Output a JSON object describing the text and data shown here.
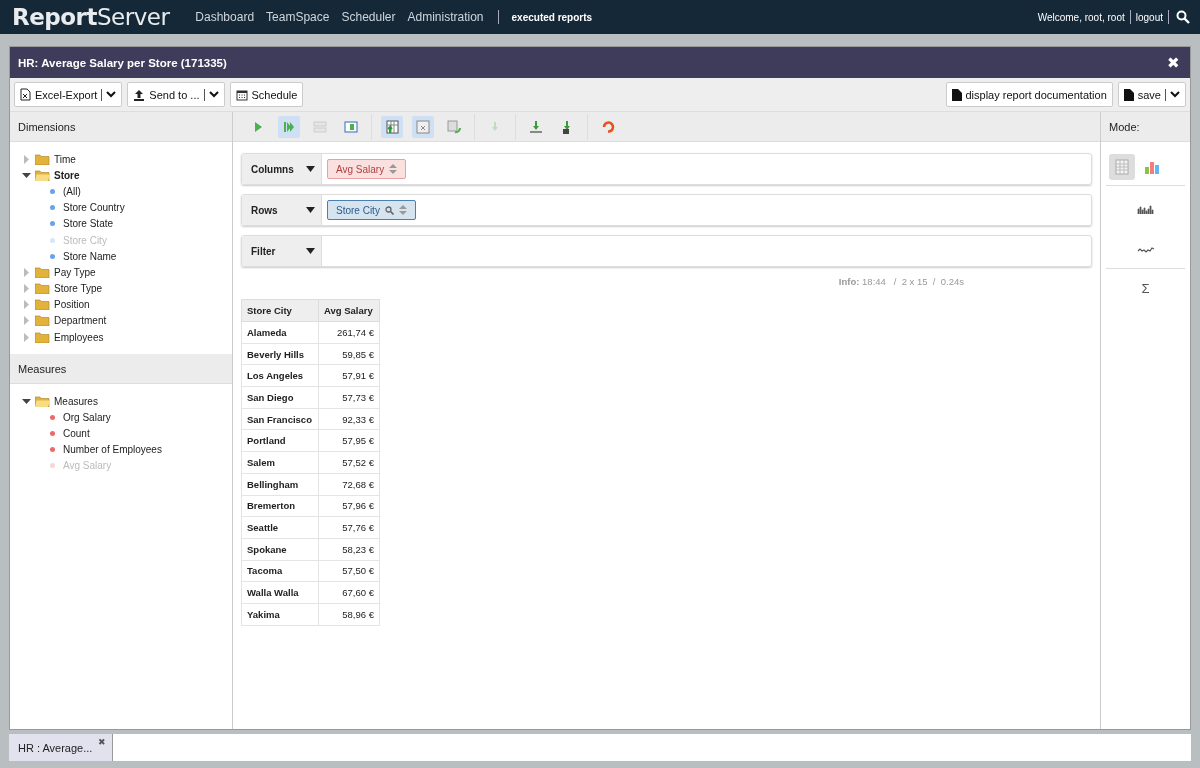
{
  "topbar": {
    "logo_bold": "Report",
    "logo_light": "Server",
    "nav": [
      "Dashboard",
      "TeamSpace",
      "Scheduler",
      "Administration"
    ],
    "current": "executed reports",
    "welcome": "Welcome, root, root",
    "logout": "logout"
  },
  "window": {
    "title": "HR: Average Salary per Store (171335)",
    "close": "✖"
  },
  "toolbar": {
    "left": [
      {
        "label": "Excel-Export",
        "kind": "excel",
        "dropdown": true
      },
      {
        "label": "Send to ...",
        "kind": "upload",
        "dropdown": true
      },
      {
        "label": "Schedule",
        "kind": "calendar",
        "dropdown": false
      }
    ],
    "right": [
      {
        "label": "display report documentation",
        "kind": "doc",
        "dropdown": false
      },
      {
        "label": "save",
        "kind": "doc",
        "dropdown": true
      }
    ]
  },
  "dimensions": {
    "title": "Dimensions",
    "items": [
      {
        "label": "Time",
        "kind": "folder",
        "expanded": false
      },
      {
        "label": "Store",
        "kind": "folder",
        "expanded": true,
        "children": [
          {
            "label": "(All)",
            "kind": "level",
            "disabled": false
          },
          {
            "label": "Store Country",
            "kind": "level",
            "disabled": false
          },
          {
            "label": "Store State",
            "kind": "level",
            "disabled": false
          },
          {
            "label": "Store City",
            "kind": "level",
            "disabled": true
          },
          {
            "label": "Store Name",
            "kind": "level",
            "disabled": false
          }
        ]
      },
      {
        "label": "Pay Type",
        "kind": "folder",
        "expanded": false
      },
      {
        "label": "Store Type",
        "kind": "folder",
        "expanded": false
      },
      {
        "label": "Position",
        "kind": "folder",
        "expanded": false
      },
      {
        "label": "Department",
        "kind": "folder",
        "expanded": false
      },
      {
        "label": "Employees",
        "kind": "folder",
        "expanded": false
      }
    ]
  },
  "measures": {
    "title": "Measures",
    "items": [
      {
        "label": "Measures",
        "kind": "folder",
        "expanded": true,
        "children": [
          {
            "label": "Org Salary",
            "kind": "measure",
            "disabled": false
          },
          {
            "label": "Count",
            "kind": "measure",
            "disabled": false
          },
          {
            "label": "Number of Employees",
            "kind": "measure",
            "disabled": false
          },
          {
            "label": "Avg Salary",
            "kind": "measure",
            "disabled": true
          }
        ]
      }
    ]
  },
  "pivot_toolbar": [
    {
      "kind": "run",
      "selected": false,
      "disabled": false
    },
    {
      "kind": "run-all",
      "selected": true,
      "disabled": false
    },
    {
      "kind": "split",
      "selected": false,
      "disabled": true
    },
    {
      "kind": "panel",
      "selected": false,
      "disabled": false
    },
    {
      "kind": "table-up",
      "selected": true,
      "disabled": false
    },
    {
      "kind": "table-x",
      "selected": true,
      "disabled": false
    },
    {
      "kind": "table-refresh",
      "selected": false,
      "disabled": false
    },
    {
      "kind": "down",
      "selected": false,
      "disabled": true
    },
    {
      "kind": "download",
      "selected": false,
      "disabled": false
    },
    {
      "kind": "download-doc",
      "selected": false,
      "disabled": false
    },
    {
      "kind": "undo",
      "selected": false,
      "disabled": false
    }
  ],
  "drop_zones": [
    {
      "label": "Columns",
      "chips": [
        {
          "label": "Avg Salary",
          "kind": "measure",
          "search": false
        }
      ]
    },
    {
      "label": "Rows",
      "chips": [
        {
          "label": "Store City",
          "kind": "dimension",
          "search": true
        }
      ]
    },
    {
      "label": "Filter"
    }
  ],
  "info": {
    "label": "Info:",
    "text": "18:44   /  2 x 15  /  0.24s"
  },
  "table": {
    "columns": [
      "Store City",
      "Avg Salary"
    ],
    "rows": [
      [
        "Alameda",
        "261,74 €"
      ],
      [
        "Beverly Hills",
        "59,85 €"
      ],
      [
        "Los Angeles",
        "57,91 €"
      ],
      [
        "San Diego",
        "57,73 €"
      ],
      [
        "San Francisco",
        "92,33 €"
      ],
      [
        "Portland",
        "57,95 €"
      ],
      [
        "Salem",
        "57,52 €"
      ],
      [
        "Bellingham",
        "72,68 €"
      ],
      [
        "Bremerton",
        "57,96 €"
      ],
      [
        "Seattle",
        "57,76 €"
      ],
      [
        "Spokane",
        "58,23 €"
      ],
      [
        "Tacoma",
        "57,50 €"
      ],
      [
        "Walla Walla",
        "67,60 €"
      ],
      [
        "Yakima",
        "58,96 €"
      ]
    ]
  },
  "mode": {
    "title": "Mode:",
    "views": [
      {
        "kind": "table",
        "selected": true
      },
      {
        "kind": "chart",
        "selected": false
      }
    ],
    "sigma": "Σ"
  },
  "bottom_tabs": [
    {
      "label": "HR : Average...",
      "close": "✖",
      "selected": true
    }
  ]
}
